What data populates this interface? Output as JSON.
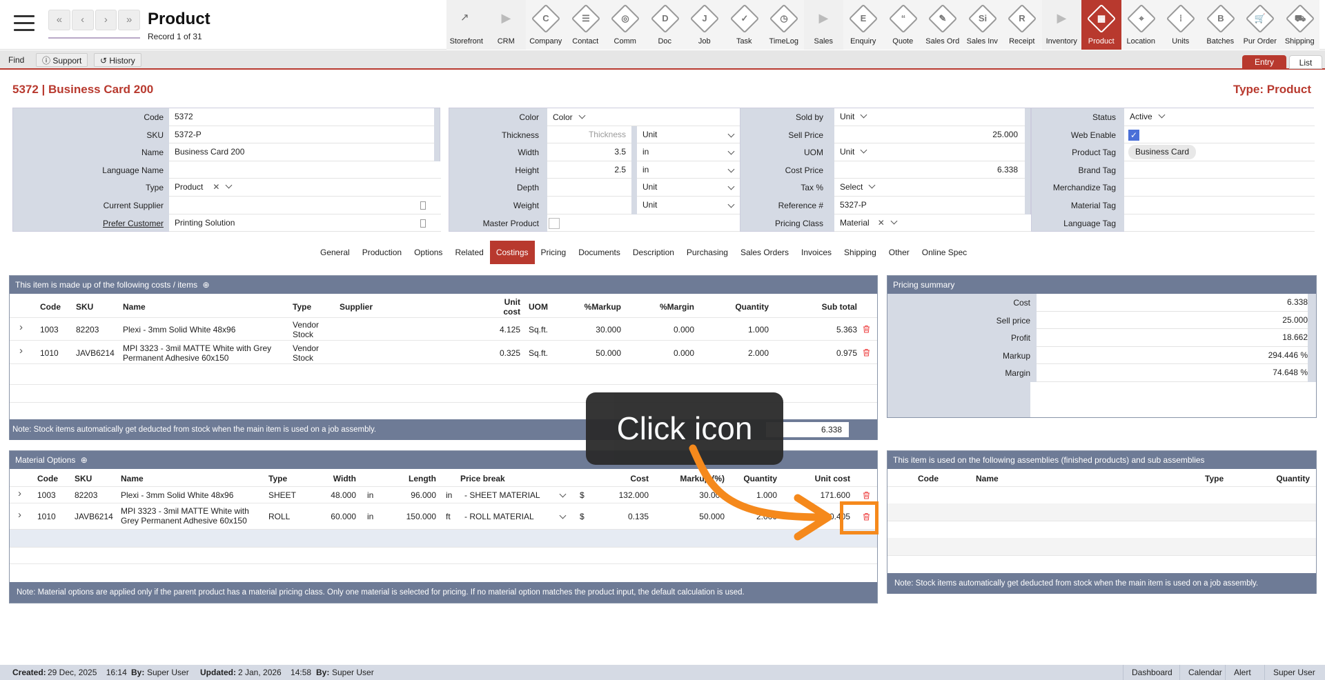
{
  "header": {
    "title": "Product",
    "record_info": "Record 1 of 31",
    "nav": [
      "«",
      "‹",
      "›",
      "»"
    ]
  },
  "modules": [
    {
      "label": "Storefront",
      "glyph": "↗",
      "kind": "plain"
    },
    {
      "label": "CRM",
      "glyph": "▶",
      "kind": "arrow"
    },
    {
      "label": "Company",
      "glyph": "C",
      "kind": "icon"
    },
    {
      "label": "Contact",
      "glyph": "☰",
      "kind": "icon"
    },
    {
      "label": "Comm",
      "glyph": "◎",
      "kind": "icon"
    },
    {
      "label": "Doc",
      "glyph": "D",
      "kind": "icon"
    },
    {
      "label": "Job",
      "glyph": "J",
      "kind": "icon"
    },
    {
      "label": "Task",
      "glyph": "✓",
      "kind": "icon"
    },
    {
      "label": "TimeLog",
      "glyph": "◷",
      "kind": "icon"
    },
    {
      "label": "Sales",
      "glyph": "▶",
      "kind": "arrow"
    },
    {
      "label": "Enquiry",
      "glyph": "E",
      "kind": "icon"
    },
    {
      "label": "Quote",
      "glyph": "“",
      "kind": "icon"
    },
    {
      "label": "Sales Ord",
      "glyph": "✎",
      "kind": "icon"
    },
    {
      "label": "Sales Inv",
      "glyph": "Si",
      "kind": "icon"
    },
    {
      "label": "Receipt",
      "glyph": "R",
      "kind": "icon"
    },
    {
      "label": "Inventory",
      "glyph": "▶",
      "kind": "arrow"
    },
    {
      "label": "Product",
      "glyph": "▦",
      "kind": "active"
    },
    {
      "label": "Location",
      "glyph": "⌖",
      "kind": "icon"
    },
    {
      "label": "Units",
      "glyph": "⁞",
      "kind": "icon"
    },
    {
      "label": "Batches",
      "glyph": "B",
      "kind": "icon"
    },
    {
      "label": "Pur Order",
      "glyph": "🛒",
      "kind": "icon"
    },
    {
      "label": "Shipping",
      "glyph": "⛟",
      "kind": "icon"
    }
  ],
  "toolbar": {
    "find": "Find",
    "support": "Support",
    "history": "History",
    "entry_tab": "Entry",
    "list_tab": "List"
  },
  "record": {
    "heading": "5372 | Business Card 200",
    "type_heading": "Type: Product"
  },
  "form1": {
    "code_label": "Code",
    "code": "5372",
    "sku_label": "SKU",
    "sku": "5372-P",
    "name_label": "Name",
    "name": "Business Card 200",
    "language_name_label": "Language Name",
    "language_name": "",
    "type_label": "Type",
    "type": "Product",
    "current_supplier_label": "Current Supplier",
    "current_supplier": "",
    "prefer_customer_label": "Prefer Customer",
    "prefer_customer": "Printing Solution"
  },
  "form2": {
    "color_label": "Color",
    "color": "Color",
    "thickness_label": "Thickness",
    "thickness_placeholder": "Thickness",
    "thickness_unit": "Unit",
    "width_label": "Width",
    "width": "3.5",
    "width_unit": "in",
    "height_label": "Height",
    "height": "2.5",
    "height_unit": "in",
    "depth_label": "Depth",
    "depth_unit": "Unit",
    "weight_label": "Weight",
    "weight_unit": "Unit",
    "master_product_label": "Master Product"
  },
  "form3": {
    "sold_by_label": "Sold by",
    "sold_by": "Unit",
    "sell_price_label": "Sell Price",
    "sell_price": "25.000",
    "uom_label": "UOM",
    "uom": "Unit",
    "cost_price_label": "Cost Price",
    "cost_price": "6.338",
    "tax_label": "Tax %",
    "tax": "Select",
    "reference_label": "Reference #",
    "reference": "5327-P",
    "pricing_class_label": "Pricing Class",
    "pricing_class": "Material"
  },
  "form4": {
    "status_label": "Status",
    "status": "Active",
    "web_enable_label": "Web Enable",
    "web_enable_mark": "✓",
    "product_tag_label": "Product Tag",
    "product_tag": "Business Card",
    "brand_tag_label": "Brand Tag",
    "merchandize_tag_label": "Merchandize Tag",
    "material_tag_label": "Material Tag",
    "language_tag_label": "Language Tag"
  },
  "tabs": [
    "General",
    "Production",
    "Options",
    "Related",
    "Costings",
    "Pricing",
    "Documents",
    "Description",
    "Purchasing",
    "Sales Orders",
    "Invoices",
    "Shipping",
    "Other",
    "Online Spec"
  ],
  "costs": {
    "title": "This item is made up of the following costs / items",
    "headers": {
      "code": "Code",
      "sku": "SKU",
      "name": "Name",
      "type": "Type",
      "supplier": "Supplier",
      "unit_cost": "Unit cost",
      "uom": "UOM",
      "markup": "%Markup",
      "margin": "%Margin",
      "quantity": "Quantity",
      "subtotal": "Sub total"
    },
    "rows": [
      {
        "code": "1003",
        "sku": "82203",
        "name": "Plexi - 3mm Solid White 48x96",
        "type": "Vendor Stock",
        "supplier": "",
        "unit_cost": "4.125",
        "uom": "Sq.ft.",
        "markup": "30.000",
        "margin": "0.000",
        "quantity": "1.000",
        "subtotal": "5.363"
      },
      {
        "code": "1010",
        "sku": "JAVB6214",
        "name": "MPI 3323 - 3mil MATTE White with Grey Permanent Adhesive 60x150",
        "type": "Vendor Stock",
        "supplier": "",
        "unit_cost": "0.325",
        "uom": "Sq.ft.",
        "markup": "50.000",
        "margin": "0.000",
        "quantity": "2.000",
        "subtotal": "0.975"
      }
    ],
    "note": "Note: Stock items automatically get deducted from stock when the main item is used on a job assembly.",
    "total_label": "ost",
    "total": "6.338"
  },
  "summary": {
    "title": "Pricing summary",
    "rows": [
      {
        "label": "Cost",
        "value": "6.338"
      },
      {
        "label": "Sell price",
        "value": "25.000"
      },
      {
        "label": "Profit",
        "value": "18.662"
      },
      {
        "label": "Markup",
        "value": "294.446 %"
      },
      {
        "label": "Margin",
        "value": "74.648 %"
      }
    ]
  },
  "materials": {
    "title": "Material Options",
    "headers": {
      "code": "Code",
      "sku": "SKU",
      "name": "Name",
      "type": "Type",
      "width": "Width",
      "length": "Length",
      "price_break": "Price break",
      "cost": "Cost",
      "markup": "Markup (%)",
      "quantity": "Quantity",
      "unit_cost": "Unit cost"
    },
    "rows": [
      {
        "code": "1003",
        "sku": "82203",
        "name": "Plexi - 3mm Solid White 48x96",
        "type": "SHEET",
        "width": "48.000",
        "wunit": "in",
        "length": "96.000",
        "lunit": "in",
        "price_break": "- SHEET MATERIAL",
        "cur": "$",
        "cost": "132.000",
        "markup": "30.000",
        "quantity": "1.000",
        "unit_cost": "171.600"
      },
      {
        "code": "1010",
        "sku": "JAVB6214",
        "name": "MPI 3323 - 3mil MATTE White with Grey Permanent Adhesive 60x150",
        "type": "ROLL",
        "width": "60.000",
        "wunit": "in",
        "length": "150.000",
        "lunit": "ft",
        "price_break": "- ROLL MATERIAL",
        "cur": "$",
        "cost": "0.135",
        "markup": "50.000",
        "quantity": "2.000",
        "unit_cost": "0.405"
      }
    ],
    "note": "Note: Material options are applied only if the parent product has a material pricing class. Only one material is selected for pricing. If no material option matches the product input, the default calculation is used."
  },
  "assemblies": {
    "title": "This item is used on the following assemblies (finished products) and sub assemblies",
    "headers": {
      "code": "Code",
      "name": "Name",
      "type": "Type",
      "quantity": "Quantity"
    },
    "note": "Note: Stock items automatically get deducted from stock when the main item is used on a job assembly."
  },
  "overlay": {
    "text": "Click icon",
    "color": "#f5891c"
  },
  "footer": {
    "created_label": "Created:",
    "created": "29 Dec, 2025    16:14",
    "by_label": "By:",
    "created_by": "Super User",
    "updated_label": "Updated:",
    "updated": "2 Jan, 2026    14:58",
    "by2_label": "By:",
    "updated_by": "Super User",
    "buttons": [
      "Dashboard",
      "Calendar",
      "Alert",
      "Super User"
    ]
  }
}
